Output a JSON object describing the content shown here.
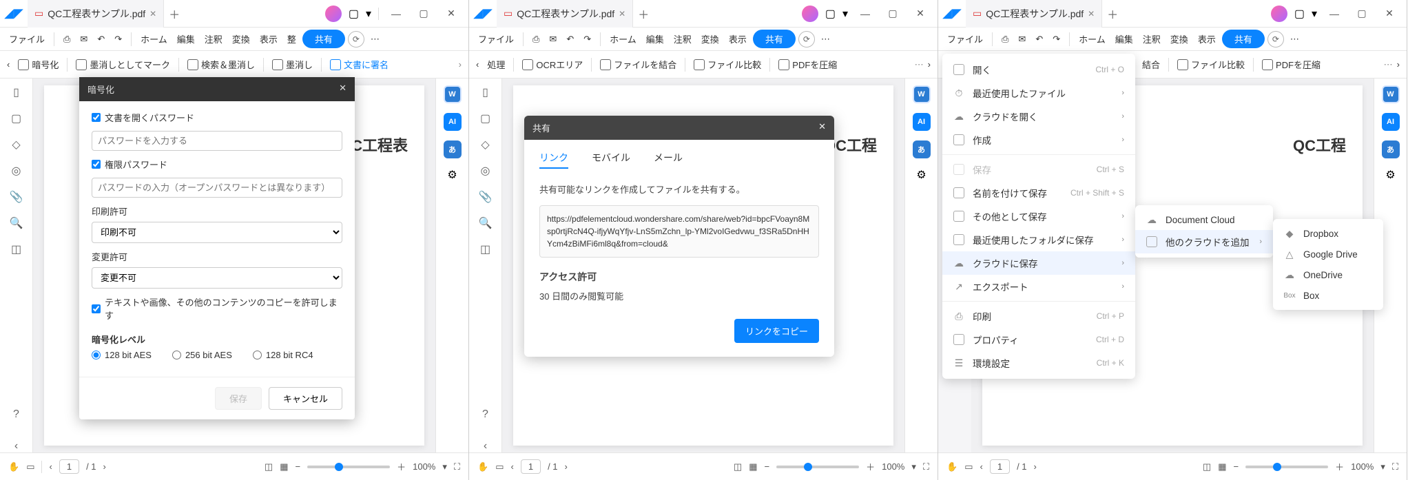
{
  "tab_title": "QC工程表サンプル.pdf",
  "menubar": {
    "file": "ファイル",
    "home": "ホーム",
    "edit": "編集",
    "annotate": "注釈",
    "convert": "変換",
    "display": "表示",
    "arrange": "整",
    "share": "共有"
  },
  "p1_toolbar": {
    "encrypt": "暗号化",
    "redact_mark": "墨消しとしてマーク",
    "search_redact": "検索＆墨消し",
    "redact": "墨消し",
    "sign": "文書に署名"
  },
  "p2_toolbar": {
    "process": "処理",
    "ocr": "OCRエリア",
    "combine": "ファイルを結合",
    "compare": "ファイル比較",
    "compress": "PDFを圧縮"
  },
  "p3_toolbar": {
    "combine": "結合",
    "compare": "ファイル比較",
    "compress": "PDFを圧縮"
  },
  "doc_heading_p1": "C工程表",
  "doc_heading_p23": "QC工程",
  "enc": {
    "title": "暗号化",
    "open_pw": "文書を開くパスワード",
    "open_pw_ph": "パスワードを入力する",
    "perm_pw": "権限パスワード",
    "perm_pw_ph": "パスワードの入力（オープンパスワードとは異なります）",
    "print_perm": "印刷許可",
    "print_val": "印刷不可",
    "change_perm": "変更許可",
    "change_val": "変更不可",
    "copy_allow": "テキストや画像、その他のコンテンツのコピーを許可します",
    "level": "暗号化レベル",
    "r1": "128 bit AES",
    "r2": "256 bit AES",
    "r3": "128 bit RC4",
    "save": "保存",
    "cancel": "キャンセル"
  },
  "sharedlg": {
    "title": "共有",
    "tab_link": "リンク",
    "tab_mobile": "モバイル",
    "tab_mail": "メール",
    "desc": "共有可能なリンクを作成してファイルを共有する。",
    "url": "https://pdfelementcloud.wondershare.com/share/web?id=bpcFVoayn8Msp0rtjRcN4Q-ifjyWqYfjv-LnS5mZchn_lp-YMl2voIGedvwu_f3SRa5DnHHYcm4zBiMFi6ml8q&from=cloud&",
    "perm_h": "アクセス許可",
    "perm_txt": "30 日間のみ閲覧可能",
    "copy": "リンクをコピー"
  },
  "filemenu": {
    "open": "開く",
    "open_sc": "Ctrl + O",
    "recent": "最近使用したファイル",
    "cloud_open": "クラウドを開く",
    "create": "作成",
    "save": "保存",
    "save_sc": "Ctrl + S",
    "saveas": "名前を付けて保存",
    "saveas_sc": "Ctrl + Shift + S",
    "saveother": "その他として保存",
    "recentfolder": "最近使用したフォルダに保存",
    "cloud_save": "クラウドに保存",
    "export": "エクスポート",
    "print": "印刷",
    "print_sc": "Ctrl + P",
    "props": "プロパティ",
    "props_sc": "Ctrl + D",
    "prefs": "環境設定",
    "prefs_sc": "Ctrl + K"
  },
  "cloudsub": {
    "doccloud": "Document Cloud",
    "addcloud": "他のクラウドを追加"
  },
  "cloudsub2": {
    "dropbox": "Dropbox",
    "gdrive": "Google Drive",
    "onedrive": "OneDrive",
    "box": "Box"
  },
  "status": {
    "page": "1",
    "pages": "/ 1",
    "zoom": "100%"
  }
}
